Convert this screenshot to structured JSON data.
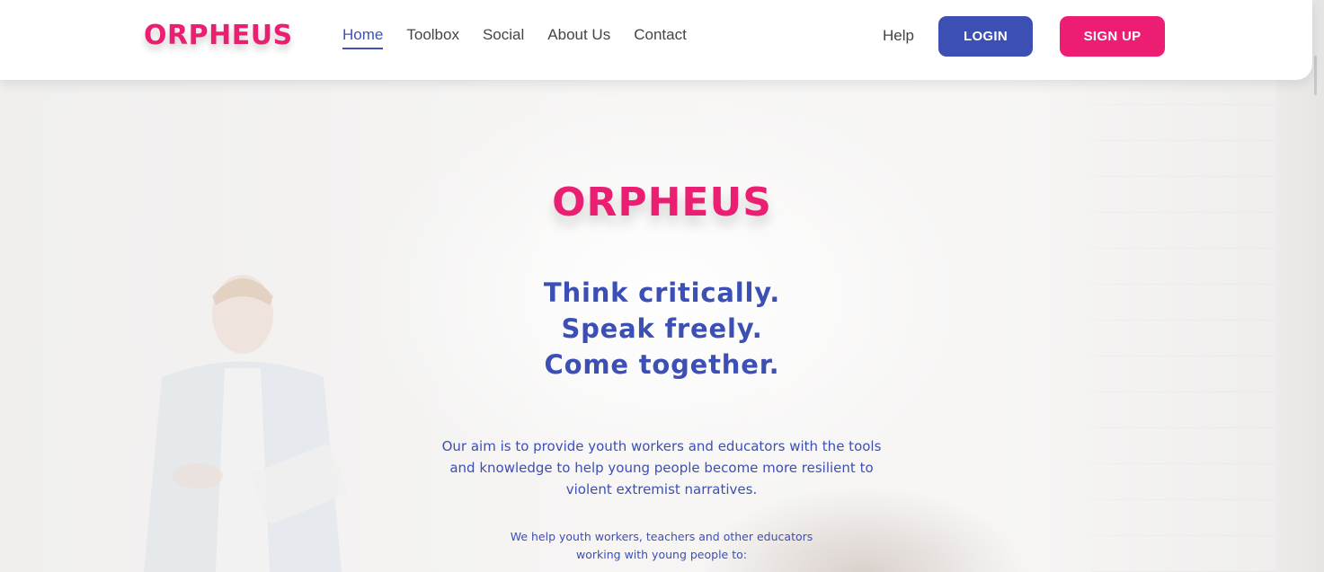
{
  "header": {
    "logo": "ORPHEUS",
    "nav": [
      {
        "label": "Home",
        "active": true
      },
      {
        "label": "Toolbox",
        "active": false
      },
      {
        "label": "Social",
        "active": false
      },
      {
        "label": "About Us",
        "active": false
      },
      {
        "label": "Contact",
        "active": false
      }
    ],
    "help_label": "Help",
    "login_label": "LOGIN",
    "signup_label": "SIGN UP"
  },
  "hero": {
    "logo": "ORPHEUS",
    "tagline": [
      "Think critically.",
      "Speak freely.",
      "Come together."
    ],
    "aim_lines": [
      "Our aim is to provide youth workers and educators with the tools",
      "and knowledge to help young people become more resilient to",
      "violent extremist narratives."
    ],
    "help_lines": [
      "We help youth workers, teachers and other educators",
      "working with young people to:"
    ]
  },
  "colors": {
    "brand_pink": "#ea1f72",
    "brand_blue": "#3c4fb4",
    "login_button": "#3c50b4",
    "signup_button": "#ec1d72"
  }
}
